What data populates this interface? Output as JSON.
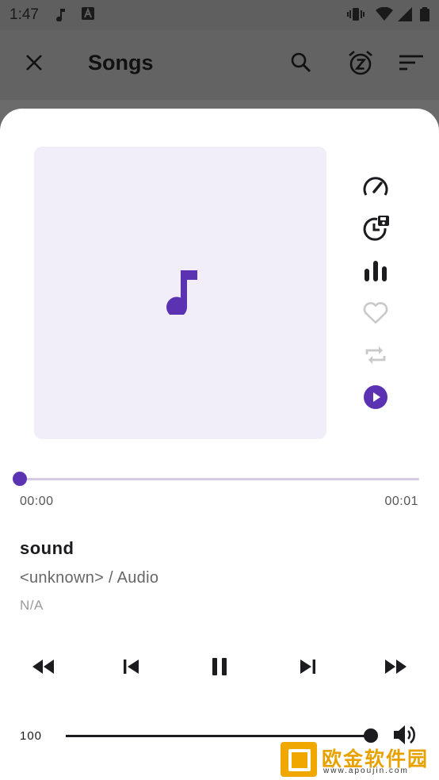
{
  "status_bar": {
    "time": "1:47",
    "icons": [
      "music-note-icon",
      "app-a-icon",
      "vibrate-icon",
      "wifi-icon",
      "signal-icon",
      "battery-icon"
    ]
  },
  "app_bar": {
    "title": "Songs",
    "actions": [
      "close-icon",
      "search-icon",
      "sleep-timer-icon",
      "sort-icon"
    ]
  },
  "player": {
    "side_actions": [
      "playback-speed-icon",
      "timer-save-icon",
      "equalizer-icon",
      "favorite-heart-icon",
      "repeat-icon",
      "play-circle-icon"
    ],
    "seek": {
      "elapsed": "00:00",
      "duration": "00:01",
      "progress": 0
    },
    "track": {
      "title": "sound",
      "artist_album": "<unknown> / Audio",
      "extra": "N/A"
    },
    "controls": [
      "fast-rewind-icon",
      "skip-previous-icon",
      "pause-icon",
      "skip-next-icon",
      "fast-forward-icon"
    ],
    "volume": {
      "label": "100",
      "level": 1.0
    }
  },
  "watermark": {
    "text": "欧金软件园",
    "url": "www.apoujin.com"
  },
  "colors": {
    "accent": "#5b33b2",
    "art_bg": "#f1eef9",
    "seek_track": "#d4cbe6",
    "disabled_icon": "#c9c9c9",
    "text_primary": "#1c1b1f",
    "text_secondary": "#666666"
  }
}
